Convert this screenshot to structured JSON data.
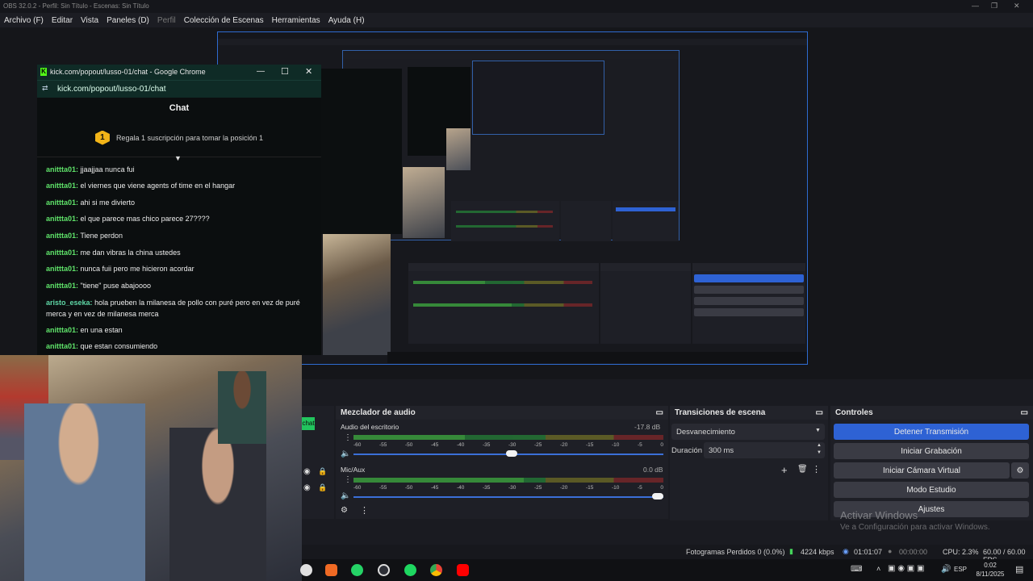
{
  "obs": {
    "title": "OBS 32.0.2 - Perfil: Sin Título - Escenas: Sin Título",
    "menu": [
      "Archivo (F)",
      "Editar",
      "Vista",
      "Paneles (D)",
      "Perfil",
      "Colección de Escenas",
      "Herramientas",
      "Ayuda (H)"
    ]
  },
  "chrome": {
    "window_title": "kick.com/popout/lusso-01/chat - Google Chrome",
    "url": "kick.com/popout/lusso-01/chat"
  },
  "chat": {
    "heading": "Chat",
    "badge_number": "1",
    "banner": "Regala 1 suscripción para tomar la posición 1",
    "messages": [
      {
        "user": "anittta01:",
        "text": "jjaajjaa nunca fui"
      },
      {
        "user": "anittta01:",
        "text": "el viernes que viene agents of time en el hangar"
      },
      {
        "user": "anittta01:",
        "text": "ahi si me divierto"
      },
      {
        "user": "anittta01:",
        "text": "el que parece mas chico parece 27????"
      },
      {
        "user": "anittta01:",
        "text": "Tiene perdon"
      },
      {
        "user": "anittta01:",
        "text": "me dan vibras la china ustedes"
      },
      {
        "user": "anittta01:",
        "text": "nunca fuii pero me hicieron acordar"
      },
      {
        "user": "anittta01:",
        "text": "\"tiene\" puse abajoooo"
      },
      {
        "user": "aristo_eseka:",
        "text": "hola prueben la milanesa de pollo con puré pero en vez de puré merca y en vez de milanesa merca"
      },
      {
        "user": "anittta01:",
        "text": "en una estan"
      },
      {
        "user": "anittta01:",
        "text": "que estan consumiendo"
      }
    ]
  },
  "mixer": {
    "title": "Mezclador de audio",
    "channels": [
      {
        "name": "Audio del escritorio",
        "db": "-17.8 dB",
        "level": 0.36
      },
      {
        "name": "Mic/Aux",
        "db": "0.0 dB",
        "level": 0.55
      }
    ],
    "ticks": [
      "-60",
      "-55",
      "-50",
      "-45",
      "-40",
      "-35",
      "-30",
      "-25",
      "-20",
      "-15",
      "-10",
      "-5",
      "0"
    ]
  },
  "transitions": {
    "title": "Transiciones de escena",
    "selected": "Desvanecimiento",
    "duration_label": "Duración",
    "duration_value": "300 ms"
  },
  "controls": {
    "title": "Controles",
    "stop_stream": "Detener Transmisión",
    "start_recording": "Iniciar Grabación",
    "virtual_camera": "Iniciar Cámara Virtual",
    "studio_mode": "Modo Estudio",
    "settings": "Ajustes"
  },
  "watermark": {
    "line1": "Activar Windows",
    "line2": "Ve a Configuración para activar Windows."
  },
  "status": {
    "dropped": "Fotogramas Perdidos 0 (0.0%)",
    "bitrate": "4224 kbps",
    "stream_time": "01:01:07",
    "rec_time": "00:00:00",
    "cpu": "CPU: 2.3%",
    "fps": "60.00 / 60.00 FPS"
  },
  "taskbar": {
    "lang": "ESP",
    "time": "0:02",
    "date": "8/11/2025"
  },
  "partial": {
    "chat_snippet": "chat"
  },
  "colors": {
    "accent": "#2e62d4",
    "chat_user": "#5fe36a"
  }
}
